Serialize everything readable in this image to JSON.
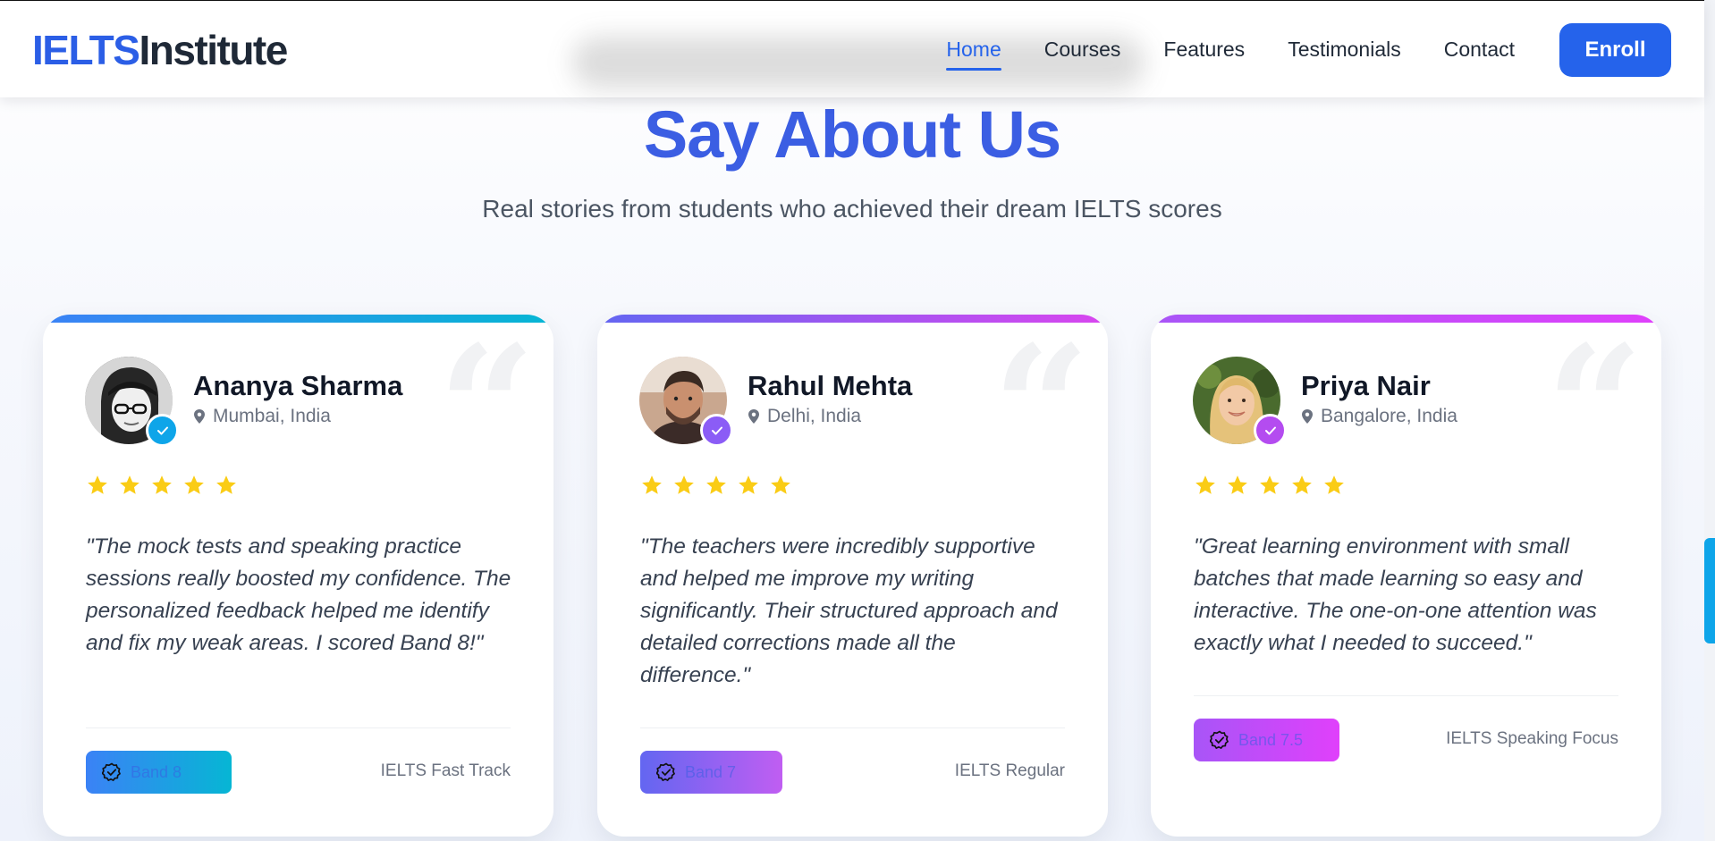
{
  "header": {
    "logo_primary": "IELTS",
    "logo_secondary": "Institute",
    "nav": [
      {
        "label": "Home",
        "active": true
      },
      {
        "label": "Courses",
        "active": false
      },
      {
        "label": "Features",
        "active": false
      },
      {
        "label": "Testimonials",
        "active": false
      },
      {
        "label": "Contact",
        "active": false
      }
    ],
    "enroll_label": "Enroll"
  },
  "section": {
    "title": "Say About Us",
    "subtitle": "Real stories from students who achieved their dream IELTS scores"
  },
  "testimonials": [
    {
      "name": "Ananya Sharma",
      "location": "Mumbai, India",
      "rating": 5,
      "quote": "\"The mock tests and speaking practice sessions really boosted my confidence. The personalized feedback helped me identify and fix my weak areas. I scored Band 8!\"",
      "badge": "Band 8",
      "program": "IELTS Fast Track",
      "accent_from": "#3b82f6",
      "accent_to": "#06b6d4"
    },
    {
      "name": "Rahul Mehta",
      "location": "Delhi, India",
      "rating": 5,
      "quote": "\"The teachers were incredibly supportive and helped me improve my writing significantly. Their structured approach and detailed corrections made all the difference.\"",
      "badge": "Band 7",
      "program": "IELTS Regular",
      "accent_from": "#6366f1",
      "accent_to": "#d946ef"
    },
    {
      "name": "Priya Nair",
      "location": "Bangalore, India",
      "rating": 5,
      "quote": "\"Great learning environment with small batches that made learning so easy and interactive. The one-on-one attention was exactly what I needed to succeed.\"",
      "badge": "Band 7.5",
      "program": "IELTS Speaking Focus",
      "accent_from": "#a855f7",
      "accent_to": "#e040fb"
    }
  ],
  "colors": {
    "brand": "#2563eb",
    "title": "#3b5ee3",
    "star": "#facc15"
  }
}
